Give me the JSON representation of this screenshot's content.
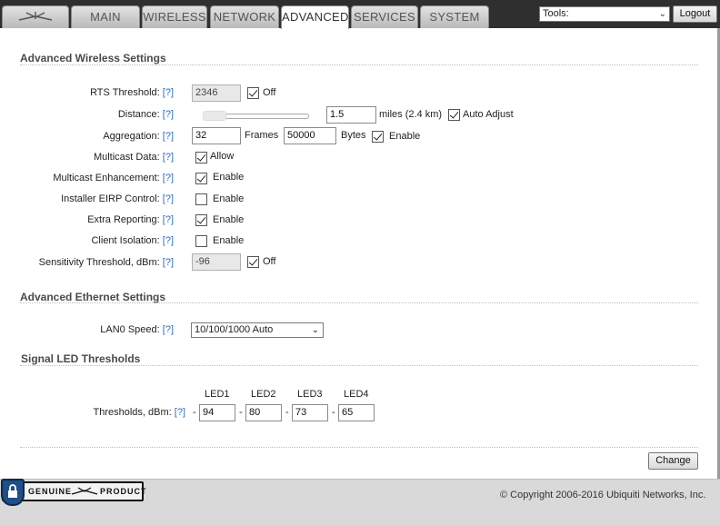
{
  "nav": {
    "tabs": [
      {
        "label": "MAIN"
      },
      {
        "label": "WIRELESS"
      },
      {
        "label": "NETWORK"
      },
      {
        "label": "ADVANCED"
      },
      {
        "label": "SERVICES"
      },
      {
        "label": "SYSTEM"
      }
    ],
    "active_tab": "ADVANCED",
    "tools_label": "Tools:",
    "logout_label": "Logout"
  },
  "help_link": "[?]",
  "wireless": {
    "title": "Advanced Wireless Settings",
    "rts": {
      "label": "RTS Threshold:",
      "value": "2346",
      "off_label": "Off",
      "off_checked": true
    },
    "distance": {
      "label": "Distance:",
      "value": "1.5",
      "unit": "miles (2.4 km)",
      "auto_label": "Auto Adjust",
      "auto_checked": true,
      "slider_fraction": 0.0
    },
    "aggregation": {
      "label": "Aggregation:",
      "frames_value": "32",
      "frames_label": "Frames",
      "bytes_value": "50000",
      "bytes_label": "Bytes",
      "enable_label": "Enable",
      "enable_checked": true
    },
    "multicast_data": {
      "label": "Multicast Data:",
      "option": "Allow",
      "checked": true
    },
    "multicast_enh": {
      "label": "Multicast Enhancement:",
      "option": "Enable",
      "checked": true
    },
    "eirp": {
      "label": "Installer EIRP Control:",
      "option": "Enable",
      "checked": false
    },
    "extra_reporting": {
      "label": "Extra Reporting:",
      "option": "Enable",
      "checked": true
    },
    "client_isolation": {
      "label": "Client Isolation:",
      "option": "Enable",
      "checked": false
    },
    "sensitivity": {
      "label": "Sensitivity Threshold, dBm:",
      "value": "-96",
      "off_label": "Off",
      "off_checked": true
    }
  },
  "ethernet": {
    "title": "Advanced Ethernet Settings",
    "lan0": {
      "label": "LAN0 Speed:",
      "value": "10/100/1000 Auto"
    }
  },
  "led": {
    "title": "Signal LED Thresholds",
    "label": "Thresholds, dBm:",
    "dash": "-",
    "leds": [
      {
        "name": "LED1",
        "value": "94"
      },
      {
        "name": "LED2",
        "value": "80"
      },
      {
        "name": "LED3",
        "value": "73"
      },
      {
        "name": "LED4",
        "value": "65"
      }
    ]
  },
  "change_label": "Change",
  "footer": {
    "copyright": "© Copyright 2006-2016 Ubiquiti Networks, Inc.",
    "badge_left": "GENUINE",
    "badge_right": "PRODUCT"
  }
}
